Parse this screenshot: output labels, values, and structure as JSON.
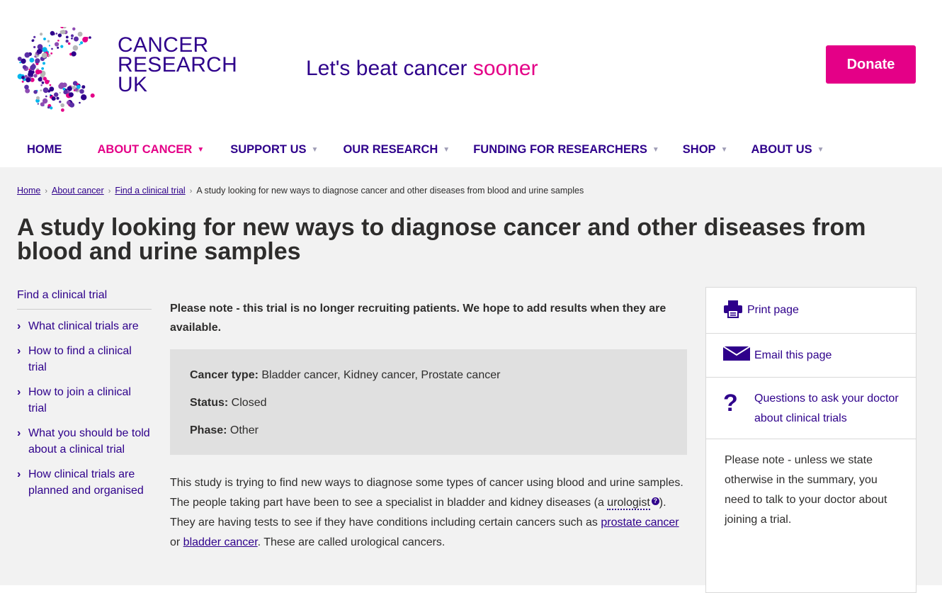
{
  "header": {
    "logo_line1": "CANCER",
    "logo_line2": "RESEARCH",
    "logo_line3": "UK",
    "tagline_main": "Let's beat cancer ",
    "tagline_accent": "sooner",
    "donate_label": "Donate",
    "colors": {
      "brand": "#2e008b",
      "accent": "#e40087"
    }
  },
  "nav": [
    {
      "label": "HOME",
      "caret": ""
    },
    {
      "label": "ABOUT CANCER",
      "caret": "▼"
    },
    {
      "label": "SUPPORT US",
      "caret": "▼"
    },
    {
      "label": "OUR RESEARCH",
      "caret": "▼"
    },
    {
      "label": "FUNDING FOR RESEARCHERS",
      "caret": "▼"
    },
    {
      "label": "SHOP",
      "caret": "▼"
    },
    {
      "label": "ABOUT US",
      "caret": "▼"
    }
  ],
  "breadcrumb": {
    "items": [
      "Home",
      "About cancer",
      "Find a clinical trial"
    ],
    "current": "A study looking for new ways to diagnose cancer and other diseases from blood and urine samples",
    "separator": "›"
  },
  "page_title": "A study looking for new ways to diagnose cancer and other diseases from blood and urine samples",
  "sidenav": {
    "title": "Find a clinical trial",
    "items": [
      "What clinical trials are",
      "How to find a clinical trial",
      "How to join a clinical trial",
      "What you should be told about a clinical trial",
      "How clinical trials are planned and organised"
    ]
  },
  "content": {
    "notice": "Please note - this trial is no longer recruiting patients. We hope to add results when they are available.",
    "summary": {
      "cancer_type_label": "Cancer type:",
      "cancer_type_value": " Bladder cancer, Kidney cancer, Prostate cancer",
      "status_label": "Status:",
      "status_value": " Closed",
      "phase_label": "Phase:",
      "phase_value": " Other"
    },
    "body": {
      "part1": "This study is trying to find new ways to diagnose some types of cancer using blood and urine samples. The people taking part have been to see a specialist in bladder and kidney diseases (a ",
      "urologist": "urologist",
      "part2": "). They are having tests to see if they have conditions including certain cancers such as ",
      "link1": "prostate cancer",
      "part3": " or ",
      "link2": "bladder cancer",
      "part4": ". These are called urological cancers."
    }
  },
  "right_panel": {
    "print_label": "Print page",
    "email_label": "Email this page",
    "questions_label": "Questions to ask your doctor about clinical trials",
    "note": "Please note - unless we state otherwise in the summary, you need to talk to your doctor about joining a trial."
  }
}
